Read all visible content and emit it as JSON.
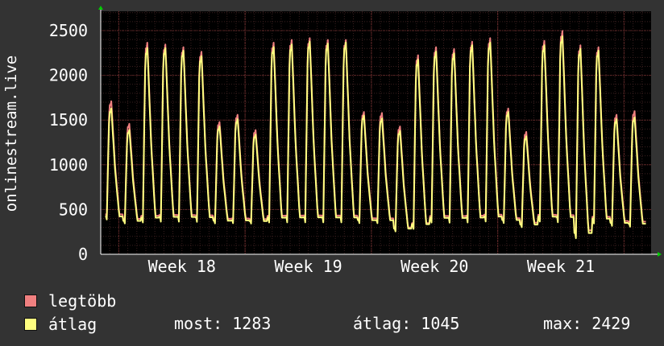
{
  "chart_data": {
    "type": "line",
    "ylabel": "onlinestream.live",
    "ylim": [
      0,
      2500
    ],
    "yticks": [
      0,
      500,
      1000,
      1500,
      2000,
      2500
    ],
    "xticks": [
      "Week 18",
      "Week 19",
      "Week 20",
      "Week 21"
    ],
    "xtick_day_positions": [
      4.5,
      11.5,
      18.5,
      25.5
    ],
    "x_range_days": [
      0,
      30.5
    ],
    "grid": true,
    "series": [
      {
        "name": "legtöbb",
        "color": "#f08080",
        "daily_peaks": [
          1700,
          1450,
          2350,
          2330,
          2300,
          2250,
          1470,
          1550,
          1380,
          2350,
          2380,
          2400,
          2380,
          2380,
          1580,
          1570,
          1420,
          2210,
          2300,
          2280,
          2360,
          2400,
          1620,
          1360,
          2370,
          2480,
          2320,
          2300,
          1550,
          1590
        ],
        "daily_troughs": [
          380,
          340,
          330,
          340,
          340,
          340,
          340,
          340,
          340,
          330,
          330,
          330,
          330,
          330,
          340,
          340,
          240,
          250,
          330,
          330,
          330,
          340,
          340,
          300,
          340,
          330,
          160,
          320,
          310,
          300
        ]
      },
      {
        "name": "átlag",
        "color": "#ffff80",
        "daily_peaks": [
          1620,
          1380,
          2290,
          2290,
          2260,
          2200,
          1420,
          1500,
          1330,
          2300,
          2330,
          2360,
          2340,
          2350,
          1540,
          1510,
          1370,
          2160,
          2250,
          2230,
          2320,
          2350,
          1580,
          1310,
          2320,
          2420,
          2280,
          2260,
          1500,
          1520
        ],
        "daily_troughs": [
          360,
          320,
          310,
          320,
          320,
          320,
          320,
          320,
          320,
          310,
          310,
          310,
          310,
          310,
          320,
          320,
          230,
          240,
          310,
          310,
          310,
          320,
          320,
          280,
          320,
          310,
          130,
          300,
          290,
          280
        ]
      }
    ]
  },
  "legend": {
    "items": [
      {
        "label": "legtöbb",
        "color": "#f08080"
      },
      {
        "label": "átlag",
        "color": "#ffff80"
      }
    ]
  },
  "stats": {
    "current": "most: 1283",
    "average": "átlag: 1045",
    "max": "max: 2429"
  }
}
